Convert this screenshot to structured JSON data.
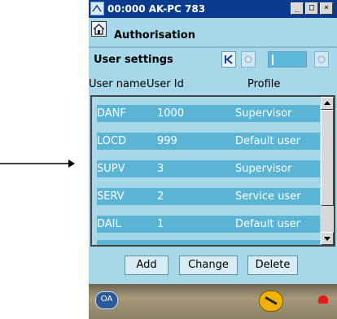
{
  "window": {
    "title": "00:000 AK-PC 783",
    "controls": [
      "_",
      "□",
      "×"
    ]
  },
  "section": {
    "title": "Authorisation"
  },
  "user_settings": {
    "title": "User settings"
  },
  "columns": [
    "User name",
    "User Id",
    "Profile"
  ],
  "rows": [
    {
      "name": "DANF",
      "id": "1000",
      "profile": "Supervisor"
    },
    {
      "name": "LOCD",
      "id": "999",
      "profile": "Default user"
    },
    {
      "name": "SUPV",
      "id": "3",
      "profile": "Supervisor"
    },
    {
      "name": "SERV",
      "id": "2",
      "profile": "Service user"
    },
    {
      "name": "DAIL",
      "id": "1",
      "profile": "Default user"
    }
  ],
  "buttons": {
    "add": "Add",
    "change": "Change",
    "delete": "Delete"
  },
  "footer": {
    "left_icon_text": "OA"
  },
  "icons": {
    "app": "controller-icon",
    "section": "home-icon",
    "nav_first": "nav-first-icon",
    "nav_prev": "nav-prev-icon",
    "nav_next": "nav-next-icon",
    "footer_tool": "wrench-icon",
    "footer_alarm": "bell-icon"
  },
  "colors": {
    "titlebar": "#0a3b8e",
    "panel": "#a6d8ea",
    "row": "#5cb4d5",
    "alarm": "#e41a1a"
  }
}
